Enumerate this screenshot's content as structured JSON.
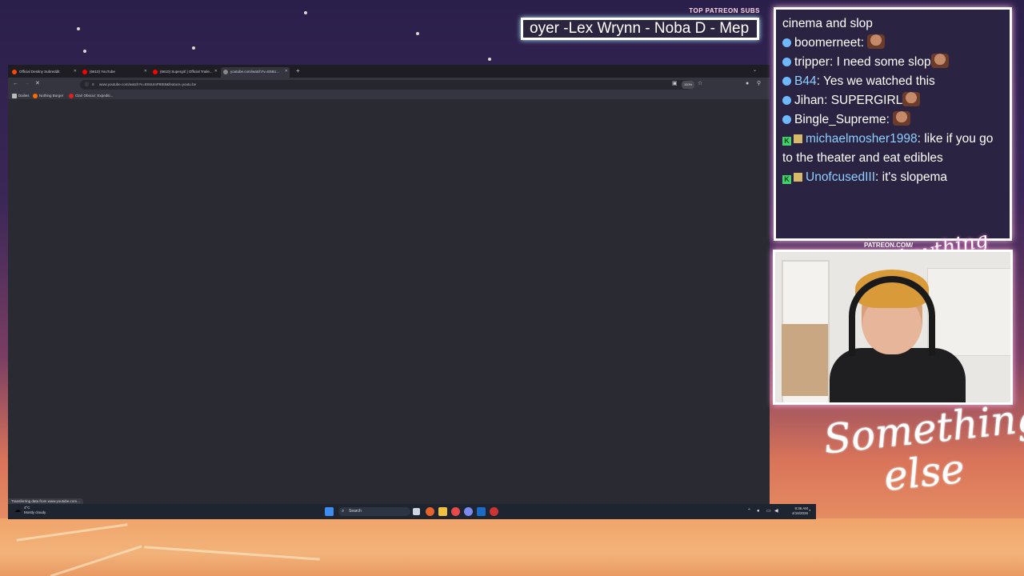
{
  "overlay": {
    "patreon_label": "TOP PATREON SUBS",
    "patreon_ticker": "oyer -Lex Wrynn -  Noba D - Mep",
    "patreon_url": "PATREON.COM/",
    "script_small": "Anything else",
    "script_big_1": "Something",
    "script_big_2": "else"
  },
  "browser": {
    "tabs": [
      {
        "label": "Official Destiny Subreddit",
        "favicon_color": "#ff4500"
      },
      {
        "label": "(6610) YouTube",
        "favicon_color": "#ff0000"
      },
      {
        "label": "(6610) Supergirl | Official Traile...",
        "favicon_color": "#ff0000"
      },
      {
        "label": "youtube.com/watch?v=8S6U...",
        "favicon_color": "#888888"
      }
    ],
    "new_tab": "+",
    "url": "www.youtube.com/watch?v=8S6UmP8tE8&feature=youtu.be",
    "zoom": "150%",
    "bookmarks": [
      {
        "label": "Dailies",
        "color": "#bbbbbb"
      },
      {
        "label": "Nothing Burger",
        "color": "#ff6a00"
      },
      {
        "label": "Clair Obscur: Expediti...",
        "color": "#e02020"
      }
    ],
    "status_text": "Transferring data from www.youtube.com..."
  },
  "taskbar": {
    "weather_temp": "4°C",
    "weather_desc": "Mostly cloudy",
    "search_label": "Search",
    "clock_time": "9:36 AM",
    "clock_date": "4/16/2026"
  },
  "chat": {
    "messages": [
      {
        "user": "",
        "text": "cinema and slop",
        "badge": "none",
        "emote": false
      },
      {
        "user": "boomerneet",
        "text": "",
        "badge": "prime",
        "emote": true
      },
      {
        "user": "tripper",
        "text": "I need some slop",
        "badge": "prime",
        "emote": true
      },
      {
        "user": "B44",
        "text": "Yes we watched this",
        "badge": "prime",
        "emote": false
      },
      {
        "user": "Jihan",
        "text": "SUPERGIRL",
        "badge": "prime",
        "emote": true
      },
      {
        "user": "Bingle_Supreme",
        "text": "",
        "badge": "prime",
        "emote": true
      },
      {
        "user": "michaelmosher1998",
        "text": "like if you go to the theater and eat edibles",
        "badge": "kick",
        "emote": false
      },
      {
        "user": "UnofcusedIII",
        "text": "it's slopema",
        "badge": "kick",
        "emote": false
      }
    ]
  },
  "colors": {
    "chat_bg": "#2a2342",
    "browser_bg": "#2a2a33",
    "accent_glow": "#ffb0e6"
  }
}
